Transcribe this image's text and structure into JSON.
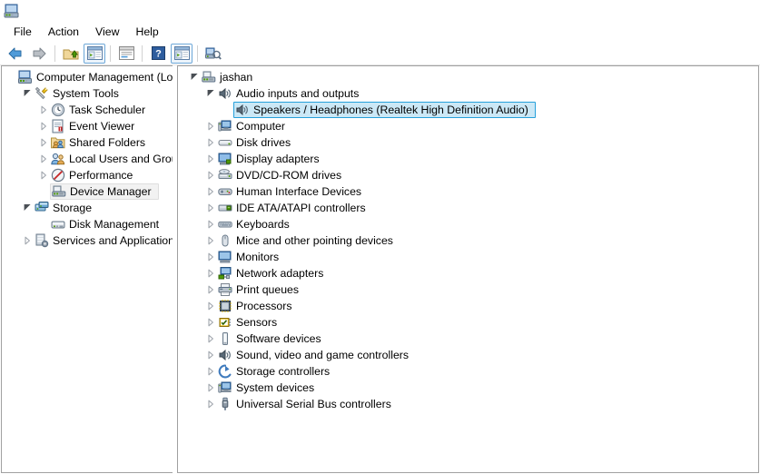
{
  "window": {
    "app_icon": "computer-management-icon"
  },
  "menubar": {
    "items": [
      {
        "label": "File",
        "name": "menu-file"
      },
      {
        "label": "Action",
        "name": "menu-action"
      },
      {
        "label": "View",
        "name": "menu-view"
      },
      {
        "label": "Help",
        "name": "menu-help"
      }
    ]
  },
  "toolbar": {
    "buttons": [
      {
        "icon": "back-arrow-icon",
        "framed": false
      },
      {
        "icon": "forward-arrow-icon",
        "framed": false
      },
      {
        "icon": "up-folder-icon",
        "framed": false
      },
      {
        "icon": "show-hide-console-tree-icon",
        "framed": true
      },
      {
        "icon": "properties-icon",
        "framed": false
      },
      {
        "icon": "help-icon",
        "framed": false
      },
      {
        "icon": "show-hide-action-pane-icon",
        "framed": true
      },
      {
        "icon": "scan-for-hardware-changes-icon",
        "framed": false
      }
    ]
  },
  "left_tree": {
    "items": [
      {
        "label": "Computer Management (Local",
        "icon": "computer-management-icon",
        "indent": 0,
        "state": "none",
        "selected": "none"
      },
      {
        "label": "System Tools",
        "icon": "system-tools-icon",
        "indent": 1,
        "state": "expanded",
        "selected": "none"
      },
      {
        "label": "Task Scheduler",
        "icon": "task-scheduler-icon",
        "indent": 2,
        "state": "collapsed",
        "selected": "none"
      },
      {
        "label": "Event Viewer",
        "icon": "event-viewer-icon",
        "indent": 2,
        "state": "collapsed",
        "selected": "none"
      },
      {
        "label": "Shared Folders",
        "icon": "shared-folders-icon",
        "indent": 2,
        "state": "collapsed",
        "selected": "none"
      },
      {
        "label": "Local Users and Groups",
        "icon": "local-users-groups-icon",
        "indent": 2,
        "state": "collapsed",
        "selected": "none"
      },
      {
        "label": "Performance",
        "icon": "performance-icon",
        "indent": 2,
        "state": "collapsed",
        "selected": "none"
      },
      {
        "label": "Device Manager",
        "icon": "device-manager-icon",
        "indent": 2,
        "state": "none",
        "selected": "inactive"
      },
      {
        "label": "Storage",
        "icon": "storage-icon",
        "indent": 1,
        "state": "expanded",
        "selected": "none"
      },
      {
        "label": "Disk Management",
        "icon": "disk-management-icon",
        "indent": 2,
        "state": "none",
        "selected": "none"
      },
      {
        "label": "Services and Applications",
        "icon": "services-apps-icon",
        "indent": 1,
        "state": "collapsed",
        "selected": "none"
      }
    ]
  },
  "device_tree": {
    "items": [
      {
        "label": "jashan",
        "icon": "computer-root-icon",
        "indent": 0,
        "state": "expanded",
        "selected": "none"
      },
      {
        "label": "Audio inputs and outputs",
        "icon": "speaker-icon",
        "indent": 1,
        "state": "expanded",
        "selected": "none"
      },
      {
        "label": "Speakers / Headphones (Realtek High Definition Audio)",
        "icon": "speaker-icon",
        "indent": 2,
        "state": "none",
        "selected": "active"
      },
      {
        "label": "Computer",
        "icon": "computer-icon",
        "indent": 1,
        "state": "collapsed",
        "selected": "none"
      },
      {
        "label": "Disk drives",
        "icon": "disk-drive-icon",
        "indent": 1,
        "state": "collapsed",
        "selected": "none"
      },
      {
        "label": "Display adapters",
        "icon": "display-adapter-icon",
        "indent": 1,
        "state": "collapsed",
        "selected": "none"
      },
      {
        "label": "DVD/CD-ROM drives",
        "icon": "dvd-drive-icon",
        "indent": 1,
        "state": "collapsed",
        "selected": "none"
      },
      {
        "label": "Human Interface Devices",
        "icon": "hid-icon",
        "indent": 1,
        "state": "collapsed",
        "selected": "none"
      },
      {
        "label": "IDE ATA/ATAPI controllers",
        "icon": "ide-controller-icon",
        "indent": 1,
        "state": "collapsed",
        "selected": "none"
      },
      {
        "label": "Keyboards",
        "icon": "keyboard-icon",
        "indent": 1,
        "state": "collapsed",
        "selected": "none"
      },
      {
        "label": "Mice and other pointing devices",
        "icon": "mouse-icon",
        "indent": 1,
        "state": "collapsed",
        "selected": "none"
      },
      {
        "label": "Monitors",
        "icon": "monitor-icon",
        "indent": 1,
        "state": "collapsed",
        "selected": "none"
      },
      {
        "label": "Network adapters",
        "icon": "network-adapter-icon",
        "indent": 1,
        "state": "collapsed",
        "selected": "none"
      },
      {
        "label": "Print queues",
        "icon": "printer-icon",
        "indent": 1,
        "state": "collapsed",
        "selected": "none"
      },
      {
        "label": "Processors",
        "icon": "processor-icon",
        "indent": 1,
        "state": "collapsed",
        "selected": "none"
      },
      {
        "label": "Sensors",
        "icon": "sensor-icon",
        "indent": 1,
        "state": "collapsed",
        "selected": "none"
      },
      {
        "label": "Software devices",
        "icon": "software-device-icon",
        "indent": 1,
        "state": "collapsed",
        "selected": "none"
      },
      {
        "label": "Sound, video and game controllers",
        "icon": "speaker-icon",
        "indent": 1,
        "state": "collapsed",
        "selected": "none"
      },
      {
        "label": "Storage controllers",
        "icon": "storage-controller-icon",
        "indent": 1,
        "state": "collapsed",
        "selected": "none"
      },
      {
        "label": "System devices",
        "icon": "computer-icon",
        "indent": 1,
        "state": "collapsed",
        "selected": "none"
      },
      {
        "label": "Universal Serial Bus controllers",
        "icon": "usb-icon",
        "indent": 1,
        "state": "collapsed",
        "selected": "none"
      }
    ]
  },
  "colors": {
    "selection_active_bg": "#cbe8f6",
    "selection_active_border": "#26a0da",
    "selection_inactive_bg": "#f2f2f2",
    "selection_inactive_border": "#dedede",
    "pane_border": "#a0a0a0",
    "toolbar_frame": "#6ea8d8"
  }
}
